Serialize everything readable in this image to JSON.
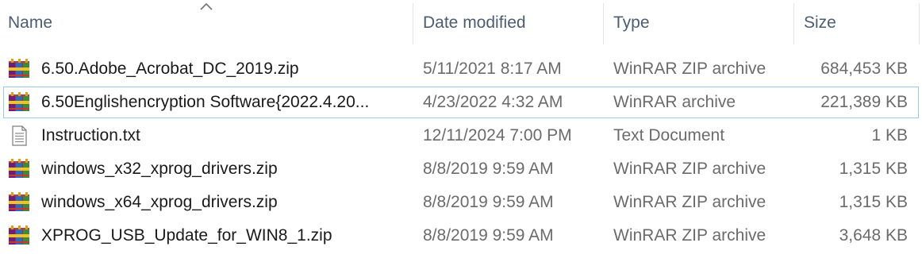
{
  "columns": {
    "name": "Name",
    "date": "Date modified",
    "type": "Type",
    "size": "Size"
  },
  "files": [
    {
      "name": "6.50.Adobe_Acrobat_DC_2019.zip",
      "date": "5/11/2021 8:17 AM",
      "type": "WinRAR ZIP archive",
      "size": "684,453 KB",
      "icon": "winrar-archive-icon"
    },
    {
      "name": "6.50Englishencryption Software{2022.4.20...",
      "date": "4/23/2022 4:32 AM",
      "type": "WinRAR archive",
      "size": "221,389 KB",
      "icon": "winrar-archive-icon"
    },
    {
      "name": "Instruction.txt",
      "date": "12/11/2024 7:00 PM",
      "type": "Text Document",
      "size": "1 KB",
      "icon": "text-file-icon"
    },
    {
      "name": "windows_x32_xprog_drivers.zip",
      "date": "8/8/2019 9:59 AM",
      "type": "WinRAR ZIP archive",
      "size": "1,315 KB",
      "icon": "winrar-archive-icon"
    },
    {
      "name": "windows_x64_xprog_drivers.zip",
      "date": "8/8/2019 9:59 AM",
      "type": "WinRAR ZIP archive",
      "size": "1,315 KB",
      "icon": "winrar-archive-icon"
    },
    {
      "name": "XPROG_USB_Update_for_WIN8_1.zip",
      "date": "8/8/2019 9:59 AM",
      "type": "WinRAR ZIP archive",
      "size": "3,648 KB",
      "icon": "winrar-archive-icon"
    }
  ]
}
